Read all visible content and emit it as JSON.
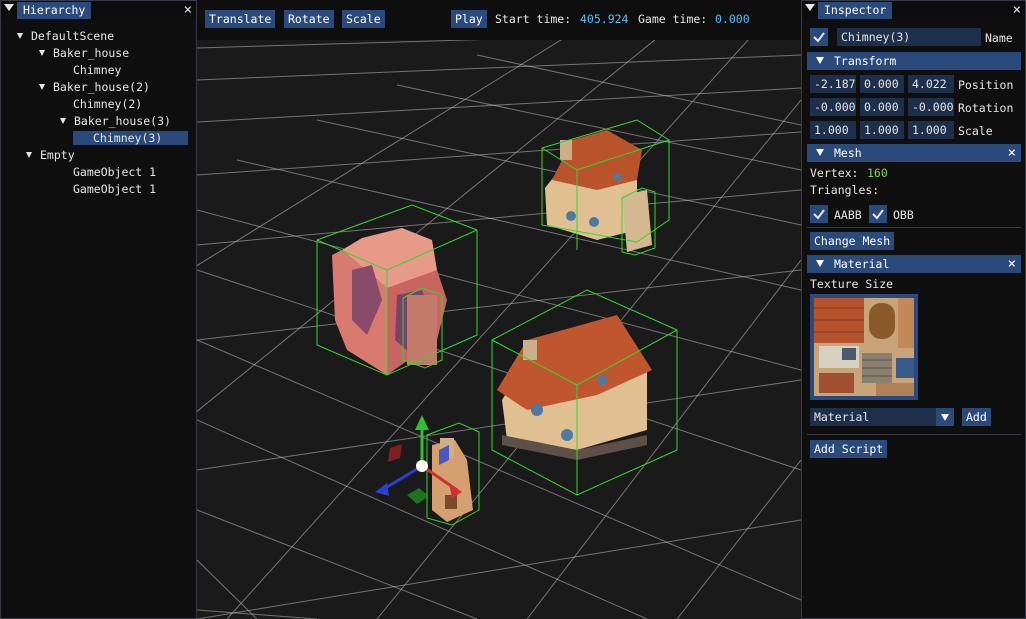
{
  "hierarchy": {
    "title": "Hierarchy",
    "items": [
      {
        "label": "DefaultScene",
        "arrow": true
      },
      {
        "label": "Baker_house",
        "arrow": true
      },
      {
        "label": "Chimney",
        "arrow": false
      },
      {
        "label": "Baker_house(2)",
        "arrow": true
      },
      {
        "label": "Chimney(2)",
        "arrow": false
      },
      {
        "label": "Baker_house(3)",
        "arrow": true
      },
      {
        "label": "Chimney(3)",
        "arrow": false,
        "selected": true
      },
      {
        "label": "Empty",
        "arrow": true
      },
      {
        "label": "GameObject 1",
        "arrow": false
      },
      {
        "label": "GameObject 1",
        "arrow": false
      }
    ]
  },
  "toolbar": {
    "translate": "Translate",
    "rotate": "Rotate",
    "scale": "Scale",
    "play": "Play",
    "start_time_label": "Start time:",
    "start_time_value": "405.924",
    "game_time_label": "Game time:",
    "game_time_value": "0.000"
  },
  "inspector": {
    "title": "Inspector",
    "name_value": "Chimney(3)",
    "name_label": "Name",
    "transform": {
      "header": "Transform",
      "position": [
        "-2.187",
        "0.000",
        "4.022"
      ],
      "position_label": "Position",
      "rotation": [
        "-0.000",
        "0.000",
        "-0.000"
      ],
      "rotation_label": "Rotation",
      "scale": [
        "1.000",
        "1.000",
        "1.000"
      ],
      "scale_label": "Scale"
    },
    "mesh": {
      "header": "Mesh",
      "vertex_label": "Vertex:",
      "vertex_value": "160",
      "triangles_label": "Triangles:",
      "aabb_label": "AABB",
      "obb_label": "OBB",
      "change_mesh": "Change Mesh"
    },
    "material": {
      "header": "Material",
      "texture_size_label": "Texture Size",
      "dropdown_value": "Material",
      "add_label": "Add"
    },
    "add_script": "Add Script"
  },
  "colors": {
    "accent": "#294a7a",
    "value_cyan": "#4fc3f7",
    "value_green": "#7cd65a",
    "bbox_green": "#33d633"
  }
}
